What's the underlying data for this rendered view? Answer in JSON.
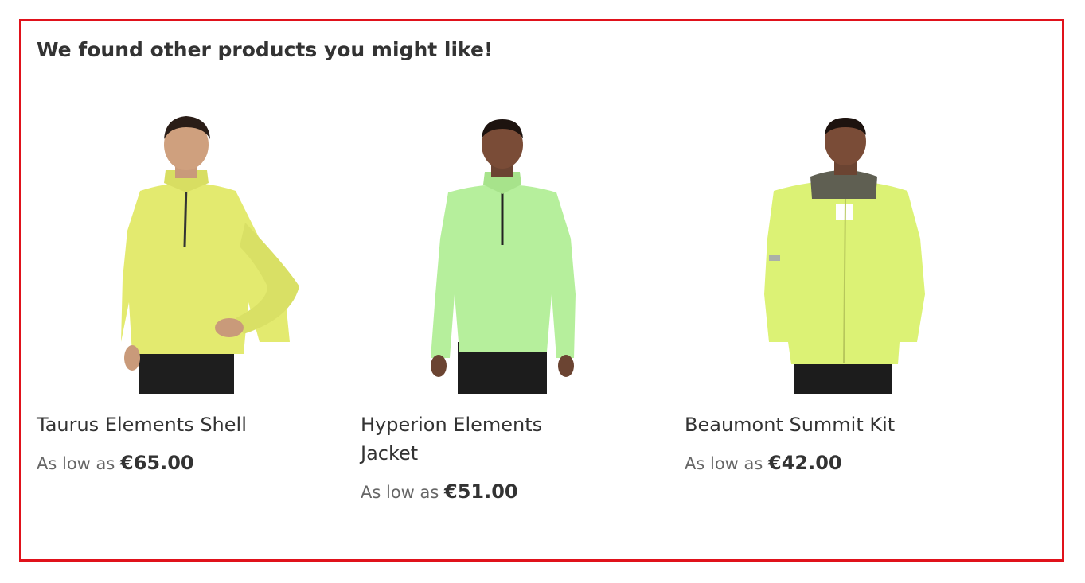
{
  "section": {
    "title": "We found other products you might like!",
    "border_color": "#e0121b"
  },
  "products": [
    {
      "name": "Taurus Elements Shell",
      "price_prefix": "As low as",
      "price": "€65.00",
      "shirt_color": "#e3ea6f",
      "image_icon": "product-photo"
    },
    {
      "name": "Hyperion Elements Jacket",
      "price_prefix": "As low as",
      "price": "€51.00",
      "shirt_color": "#b6ef9c",
      "image_icon": "product-photo"
    },
    {
      "name": "Beaumont Summit Kit",
      "price_prefix": "As low as",
      "price": "€42.00",
      "shirt_color": "#dcf275",
      "image_icon": "product-photo"
    }
  ]
}
